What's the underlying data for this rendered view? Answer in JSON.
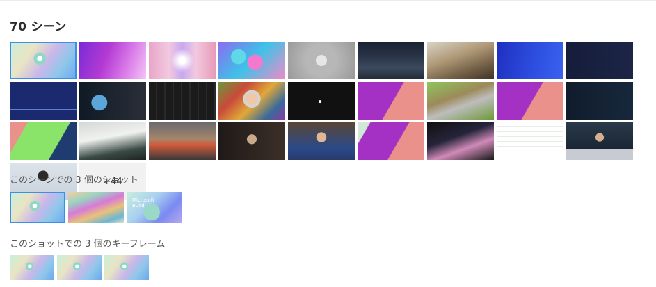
{
  "header": {
    "title": "70 シーン"
  },
  "scenes": {
    "more_label": "+44",
    "tiles": [
      {
        "id": "s1",
        "kind": "pastel-logo",
        "selected": true
      },
      {
        "id": "s2",
        "kind": "purple-wave"
      },
      {
        "id": "s3",
        "kind": "pink-window"
      },
      {
        "id": "s4",
        "kind": "colorful-orbs"
      },
      {
        "id": "s5",
        "kind": "grey-logo"
      },
      {
        "id": "s6",
        "kind": "night-street"
      },
      {
        "id": "s7",
        "kind": "building-lobby"
      },
      {
        "id": "s8",
        "kind": "blue-stage-speaker"
      },
      {
        "id": "s9",
        "kind": "navy-speaker"
      },
      {
        "id": "s10",
        "kind": "navy-speaker-line"
      },
      {
        "id": "s11",
        "kind": "blue-hair-studio"
      },
      {
        "id": "s12",
        "kind": "dark-grid-ui"
      },
      {
        "id": "s13",
        "kind": "colorful-room-person"
      },
      {
        "id": "s14",
        "kind": "black-dot"
      },
      {
        "id": "s15",
        "kind": "purple-salmon"
      },
      {
        "id": "s16",
        "kind": "minecraft"
      },
      {
        "id": "s17",
        "kind": "purple-salmon"
      },
      {
        "id": "s18",
        "kind": "navy-speaker-2"
      },
      {
        "id": "s19",
        "kind": "salmon-green-education"
      },
      {
        "id": "s20",
        "kind": "laptop-screen"
      },
      {
        "id": "s21",
        "kind": "classroom-students"
      },
      {
        "id": "s22",
        "kind": "dark-room-person"
      },
      {
        "id": "s23",
        "kind": "woman-office"
      },
      {
        "id": "s24",
        "kind": "mint-purple-salmon"
      },
      {
        "id": "s25",
        "kind": "dark-perspective-ui"
      },
      {
        "id": "s26",
        "kind": "spreadsheet"
      },
      {
        "id": "s27",
        "kind": "woman-podium"
      },
      {
        "id": "s28",
        "kind": "speaker-light"
      }
    ]
  },
  "shots_section": {
    "label": "このシーンでの 3 個のショット",
    "shots": [
      {
        "id": "sh1",
        "kind": "pastel-logo",
        "selected": true
      },
      {
        "id": "sh2",
        "kind": "ribbons"
      },
      {
        "id": "sh3",
        "kind": "build-logo",
        "text": "Microsoft Build"
      }
    ]
  },
  "keyframes_section": {
    "label": "このショットでの 3 個のキーフレーム",
    "keyframes": [
      {
        "id": "k1",
        "kind": "pastel-logo"
      },
      {
        "id": "k2",
        "kind": "pastel-logo"
      },
      {
        "id": "k3",
        "kind": "pastel-logo"
      }
    ]
  },
  "colors": {
    "accent": "#3b8fe6",
    "more_bg": "#f1f1f1"
  }
}
